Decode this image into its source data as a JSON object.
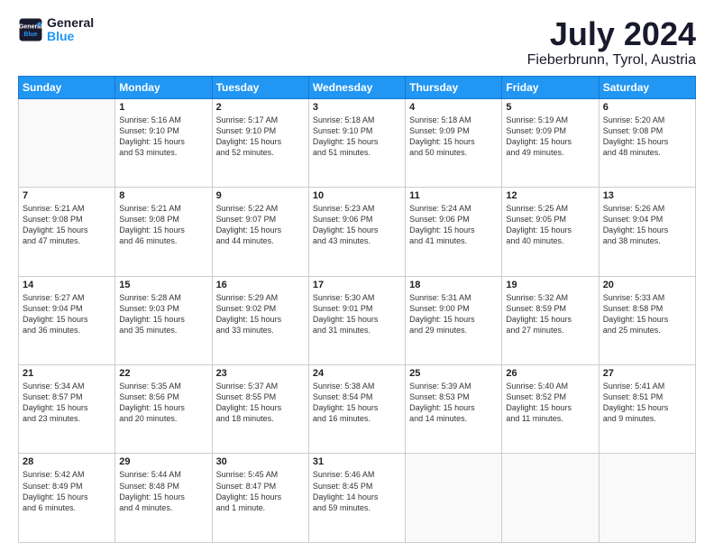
{
  "header": {
    "logo_line1": "General",
    "logo_line2": "Blue",
    "title": "July 2024",
    "subtitle": "Fieberbrunn, Tyrol, Austria"
  },
  "weekdays": [
    "Sunday",
    "Monday",
    "Tuesday",
    "Wednesday",
    "Thursday",
    "Friday",
    "Saturday"
  ],
  "weeks": [
    [
      {
        "day": "",
        "text": ""
      },
      {
        "day": "1",
        "text": "Sunrise: 5:16 AM\nSunset: 9:10 PM\nDaylight: 15 hours\nand 53 minutes."
      },
      {
        "day": "2",
        "text": "Sunrise: 5:17 AM\nSunset: 9:10 PM\nDaylight: 15 hours\nand 52 minutes."
      },
      {
        "day": "3",
        "text": "Sunrise: 5:18 AM\nSunset: 9:10 PM\nDaylight: 15 hours\nand 51 minutes."
      },
      {
        "day": "4",
        "text": "Sunrise: 5:18 AM\nSunset: 9:09 PM\nDaylight: 15 hours\nand 50 minutes."
      },
      {
        "day": "5",
        "text": "Sunrise: 5:19 AM\nSunset: 9:09 PM\nDaylight: 15 hours\nand 49 minutes."
      },
      {
        "day": "6",
        "text": "Sunrise: 5:20 AM\nSunset: 9:08 PM\nDaylight: 15 hours\nand 48 minutes."
      }
    ],
    [
      {
        "day": "7",
        "text": "Sunrise: 5:21 AM\nSunset: 9:08 PM\nDaylight: 15 hours\nand 47 minutes."
      },
      {
        "day": "8",
        "text": "Sunrise: 5:21 AM\nSunset: 9:08 PM\nDaylight: 15 hours\nand 46 minutes."
      },
      {
        "day": "9",
        "text": "Sunrise: 5:22 AM\nSunset: 9:07 PM\nDaylight: 15 hours\nand 44 minutes."
      },
      {
        "day": "10",
        "text": "Sunrise: 5:23 AM\nSunset: 9:06 PM\nDaylight: 15 hours\nand 43 minutes."
      },
      {
        "day": "11",
        "text": "Sunrise: 5:24 AM\nSunset: 9:06 PM\nDaylight: 15 hours\nand 41 minutes."
      },
      {
        "day": "12",
        "text": "Sunrise: 5:25 AM\nSunset: 9:05 PM\nDaylight: 15 hours\nand 40 minutes."
      },
      {
        "day": "13",
        "text": "Sunrise: 5:26 AM\nSunset: 9:04 PM\nDaylight: 15 hours\nand 38 minutes."
      }
    ],
    [
      {
        "day": "14",
        "text": "Sunrise: 5:27 AM\nSunset: 9:04 PM\nDaylight: 15 hours\nand 36 minutes."
      },
      {
        "day": "15",
        "text": "Sunrise: 5:28 AM\nSunset: 9:03 PM\nDaylight: 15 hours\nand 35 minutes."
      },
      {
        "day": "16",
        "text": "Sunrise: 5:29 AM\nSunset: 9:02 PM\nDaylight: 15 hours\nand 33 minutes."
      },
      {
        "day": "17",
        "text": "Sunrise: 5:30 AM\nSunset: 9:01 PM\nDaylight: 15 hours\nand 31 minutes."
      },
      {
        "day": "18",
        "text": "Sunrise: 5:31 AM\nSunset: 9:00 PM\nDaylight: 15 hours\nand 29 minutes."
      },
      {
        "day": "19",
        "text": "Sunrise: 5:32 AM\nSunset: 8:59 PM\nDaylight: 15 hours\nand 27 minutes."
      },
      {
        "day": "20",
        "text": "Sunrise: 5:33 AM\nSunset: 8:58 PM\nDaylight: 15 hours\nand 25 minutes."
      }
    ],
    [
      {
        "day": "21",
        "text": "Sunrise: 5:34 AM\nSunset: 8:57 PM\nDaylight: 15 hours\nand 23 minutes."
      },
      {
        "day": "22",
        "text": "Sunrise: 5:35 AM\nSunset: 8:56 PM\nDaylight: 15 hours\nand 20 minutes."
      },
      {
        "day": "23",
        "text": "Sunrise: 5:37 AM\nSunset: 8:55 PM\nDaylight: 15 hours\nand 18 minutes."
      },
      {
        "day": "24",
        "text": "Sunrise: 5:38 AM\nSunset: 8:54 PM\nDaylight: 15 hours\nand 16 minutes."
      },
      {
        "day": "25",
        "text": "Sunrise: 5:39 AM\nSunset: 8:53 PM\nDaylight: 15 hours\nand 14 minutes."
      },
      {
        "day": "26",
        "text": "Sunrise: 5:40 AM\nSunset: 8:52 PM\nDaylight: 15 hours\nand 11 minutes."
      },
      {
        "day": "27",
        "text": "Sunrise: 5:41 AM\nSunset: 8:51 PM\nDaylight: 15 hours\nand 9 minutes."
      }
    ],
    [
      {
        "day": "28",
        "text": "Sunrise: 5:42 AM\nSunset: 8:49 PM\nDaylight: 15 hours\nand 6 minutes."
      },
      {
        "day": "29",
        "text": "Sunrise: 5:44 AM\nSunset: 8:48 PM\nDaylight: 15 hours\nand 4 minutes."
      },
      {
        "day": "30",
        "text": "Sunrise: 5:45 AM\nSunset: 8:47 PM\nDaylight: 15 hours\nand 1 minute."
      },
      {
        "day": "31",
        "text": "Sunrise: 5:46 AM\nSunset: 8:45 PM\nDaylight: 14 hours\nand 59 minutes."
      },
      {
        "day": "",
        "text": ""
      },
      {
        "day": "",
        "text": ""
      },
      {
        "day": "",
        "text": ""
      }
    ]
  ]
}
